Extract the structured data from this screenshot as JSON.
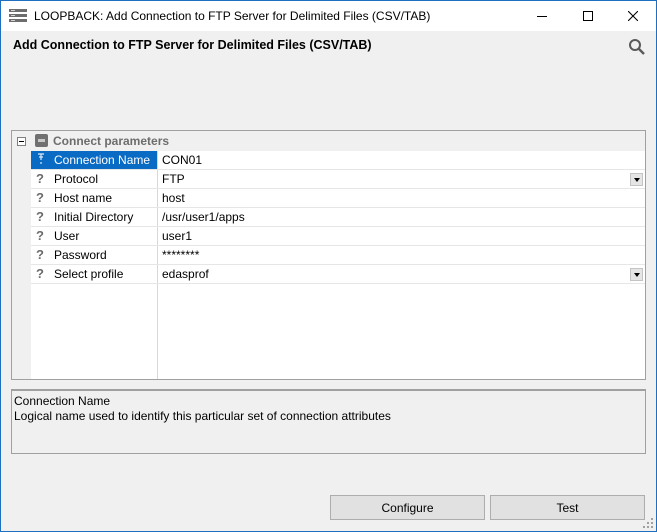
{
  "window": {
    "title": "LOOPBACK: Add Connection to FTP Server for Delimited Files (CSV/TAB)"
  },
  "dialog": {
    "heading": "Add Connection to FTP Server for Delimited Files (CSV/TAB)"
  },
  "grid": {
    "category": "Connect parameters",
    "rows": [
      {
        "name": "Connection Name",
        "value": "CON01",
        "selected": true,
        "dropdown": false
      },
      {
        "name": "Protocol",
        "value": "FTP",
        "selected": false,
        "dropdown": true
      },
      {
        "name": "Host name",
        "value": "host",
        "selected": false,
        "dropdown": false
      },
      {
        "name": "Initial Directory",
        "value": "/usr/user1/apps",
        "selected": false,
        "dropdown": false
      },
      {
        "name": "User",
        "value": "user1",
        "selected": false,
        "dropdown": false
      },
      {
        "name": "Password",
        "value": "********",
        "selected": false,
        "dropdown": false
      },
      {
        "name": "Select profile",
        "value": "edasprof",
        "selected": false,
        "dropdown": true
      }
    ]
  },
  "description": {
    "title": "Connection Name",
    "text": "Logical name used to identify this particular set of connection attributes"
  },
  "buttons": {
    "configure": "Configure",
    "test": "Test"
  },
  "colors": {
    "accent": "#0a6bc5",
    "window_border": "#1e6fbf"
  }
}
